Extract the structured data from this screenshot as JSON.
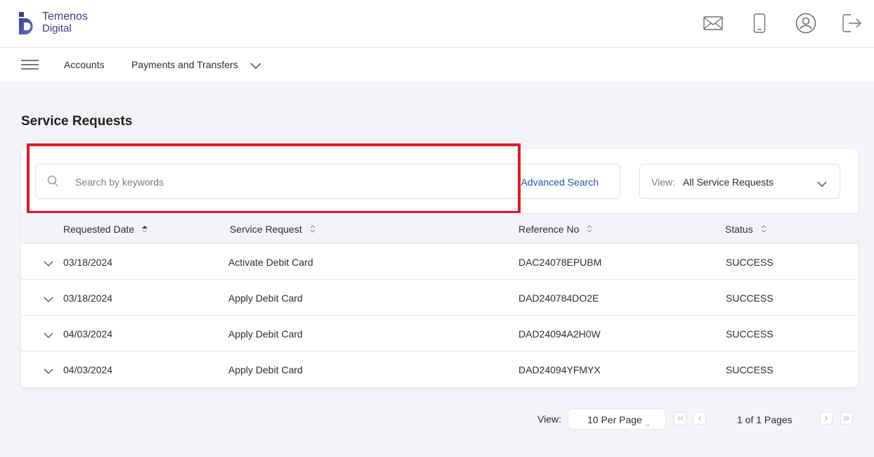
{
  "header": {
    "logo_line1": "Temenos",
    "logo_line2": "Digital",
    "icons": [
      "mail-icon",
      "mobile-icon",
      "profile-icon",
      "logout-icon"
    ]
  },
  "nav": {
    "items": [
      {
        "label": "Accounts"
      },
      {
        "label": "Payments and Transfers"
      }
    ]
  },
  "page": {
    "title": "Service Requests"
  },
  "search": {
    "placeholder": "Search by keywords",
    "value": "",
    "advanced_label": "Advanced Search"
  },
  "view_filter": {
    "label": "View:",
    "value": "All Service Requests"
  },
  "table": {
    "columns": [
      "Requested Date",
      "Service Request",
      "Reference No",
      "Status"
    ],
    "rows": [
      {
        "date": "03/18/2024",
        "request": "Activate Debit Card",
        "ref": "DAC24078EPUBM",
        "status": "SUCCESS"
      },
      {
        "date": "03/18/2024",
        "request": "Apply Debit Card",
        "ref": "DAD240784DO2E",
        "status": "SUCCESS"
      },
      {
        "date": "04/03/2024",
        "request": "Apply Debit Card",
        "ref": "DAD24094A2H0W",
        "status": "SUCCESS"
      },
      {
        "date": "04/03/2024",
        "request": "Apply Debit Card",
        "ref": "DAD24094YFMYX",
        "status": "SUCCESS"
      }
    ]
  },
  "pagination": {
    "view_label": "View:",
    "per_page": "10 Per Page",
    "info": "1 of 1 Pages"
  },
  "colors": {
    "accent": "#1a56a8",
    "brand": "#3a3f7a",
    "highlight": "#e01a2b",
    "background": "#f2f4f7"
  }
}
